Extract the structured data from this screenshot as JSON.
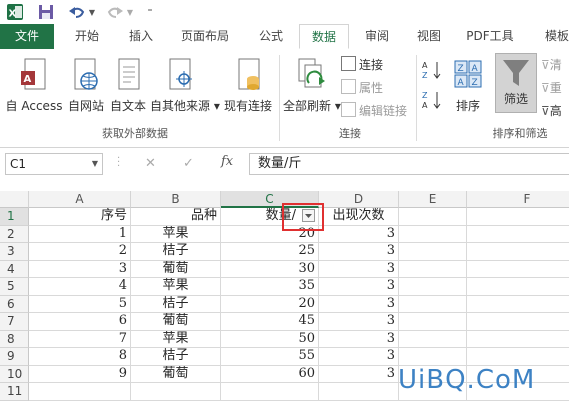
{
  "qat": {
    "excel_icon": "excel-logo-icon",
    "save_icon": "save-icon",
    "undo_icon": "undo-icon",
    "redo_icon": "redo-icon"
  },
  "tabs": [
    {
      "label": "文件"
    },
    {
      "label": "开始"
    },
    {
      "label": "插入"
    },
    {
      "label": "页面布局"
    },
    {
      "label": "公式"
    },
    {
      "label": "数据"
    },
    {
      "label": "审阅"
    },
    {
      "label": "视图"
    },
    {
      "label": "PDF工具"
    },
    {
      "label": "模板"
    }
  ],
  "ribbon": {
    "external": {
      "access": "自 Access",
      "web": "自网站",
      "text": "自文本",
      "other": "自其他来源",
      "existing": "现有连接",
      "group": "获取外部数据"
    },
    "connections": {
      "refresh_all": "全部刷新",
      "connect": "连接",
      "properties": "属性",
      "edit_links": "编辑链接",
      "group": "连接"
    },
    "sort_filter": {
      "sort": "排序",
      "filter": "筛选",
      "clear": "清",
      "reapply": "重",
      "advanced": "高",
      "group": "排序和筛选"
    }
  },
  "formula_bar": {
    "name_box": "C1",
    "cancel": "✕",
    "enter": "✓",
    "fx": "fx",
    "content": "数量/斤"
  },
  "columns": [
    "A",
    "B",
    "C",
    "D",
    "E",
    "F"
  ],
  "rows": [
    {
      "num": "1",
      "a": "序号",
      "b": "品种",
      "c": "数量/",
      "d": "出现次数"
    },
    {
      "num": "2",
      "a": "1",
      "b": "苹果",
      "c": "20",
      "d": "3"
    },
    {
      "num": "3",
      "a": "2",
      "b": "桔子",
      "c": "25",
      "d": "3"
    },
    {
      "num": "4",
      "a": "3",
      "b": "葡萄",
      "c": "30",
      "d": "3"
    },
    {
      "num": "5",
      "a": "4",
      "b": "苹果",
      "c": "35",
      "d": "3"
    },
    {
      "num": "6",
      "a": "5",
      "b": "桔子",
      "c": "20",
      "d": "3"
    },
    {
      "num": "7",
      "a": "6",
      "b": "葡萄",
      "c": "45",
      "d": "3"
    },
    {
      "num": "8",
      "a": "7",
      "b": "苹果",
      "c": "50",
      "d": "3"
    },
    {
      "num": "9",
      "a": "8",
      "b": "桔子",
      "c": "55",
      "d": "3"
    },
    {
      "num": "10",
      "a": "9",
      "b": "葡萄",
      "c": "60",
      "d": "3"
    },
    {
      "num": "11",
      "a": "",
      "b": "",
      "c": "",
      "d": ""
    }
  ],
  "watermark": "UiBQ.CoM",
  "colors": {
    "excel_green": "#217346",
    "highlight_red": "#e03030",
    "watermark_blue": "#3d82c4"
  }
}
